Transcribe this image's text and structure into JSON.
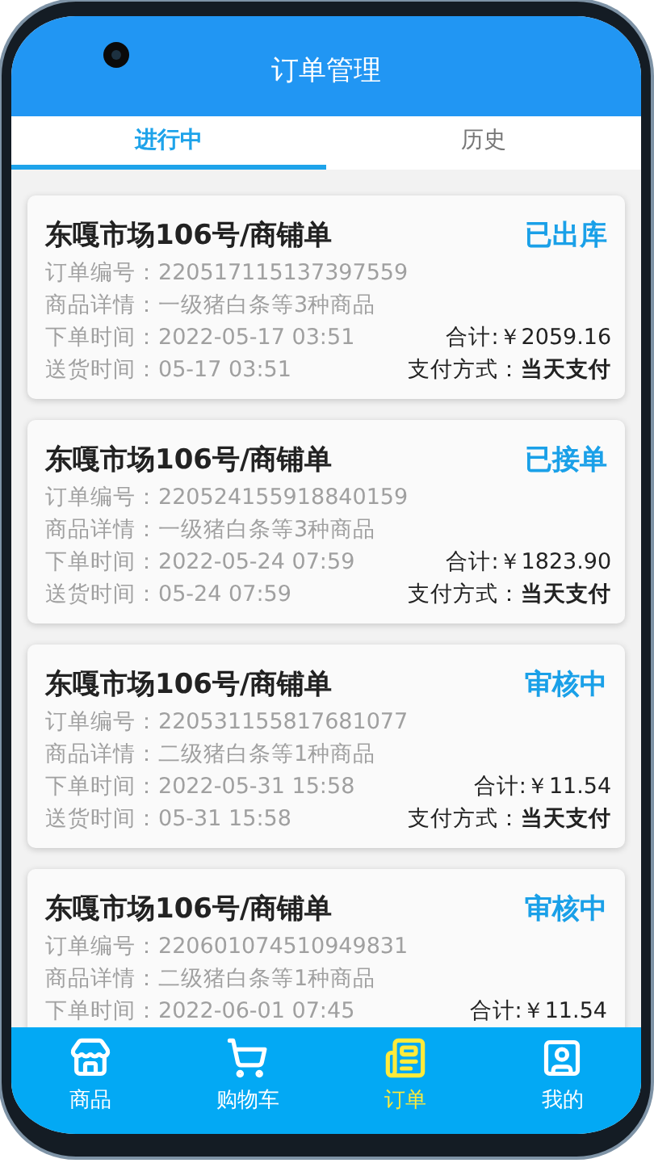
{
  "header": {
    "title": "订单管理"
  },
  "tabs": [
    {
      "label": "进行中",
      "selected": true
    },
    {
      "label": "历史",
      "selected": false
    }
  ],
  "orders": [
    {
      "title": "东嘎市场106号/商铺单",
      "status": "已出库",
      "lines": [
        "订单编号：220517115137397559",
        "商品详情：一级猪白条等3种商品",
        "下单时间：2022-05-17 03:51",
        "送货时间：05-17 03:51"
      ],
      "total": "合计:￥2059.16",
      "payment": "支付方式：**当天支付**"
    },
    {
      "title": "东嘎市场106号/商铺单",
      "status": "已接单",
      "lines": [
        "订单编号：220524155918840159",
        "商品详情：一级猪白条等3种商品",
        "下单时间：2022-05-24 07:59",
        "送货时间：05-24 07:59"
      ],
      "total": "合计:￥1823.90",
      "payment": "支付方式：**当天支付**"
    },
    {
      "title": "东嘎市场106号/商铺单",
      "status": "审核中",
      "lines": [
        "订单编号：220531155817681077",
        "商品详情：二级猪白条等1种商品",
        "下单时间：2022-05-31 15:58",
        "送货时间：05-31 15:58"
      ],
      "total": "合计:￥11.54",
      "payment": "支付方式：**当天支付**"
    },
    {
      "title": "东嘎市场106号/商铺单",
      "status": "审核中",
      "lines": [
        "订单编号：220601074510949831",
        "商品详情：二级猪白条等1种商品",
        "下单时间：2022-06-01 07:45"
      ],
      "total": "合计:￥11.54"
    }
  ],
  "nav": [
    {
      "kind": "store",
      "label": "商品",
      "selected": false
    },
    {
      "kind": "cart",
      "label": "购物车",
      "selected": false
    },
    {
      "kind": "orders",
      "label": "订单",
      "selected": true
    },
    {
      "kind": "profile",
      "label": "我的",
      "selected": false
    }
  ]
}
